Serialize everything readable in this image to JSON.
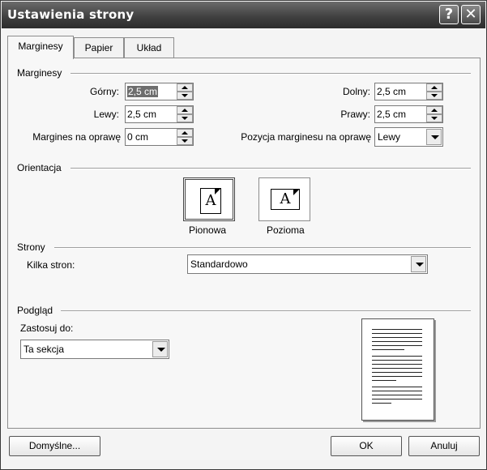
{
  "window": {
    "title": "Ustawienia strony",
    "help_glyph": "?",
    "close_glyph": "✕"
  },
  "tabs": [
    {
      "label": "Marginesy",
      "active": true
    },
    {
      "label": "Papier",
      "active": false
    },
    {
      "label": "Układ",
      "active": false
    }
  ],
  "margins": {
    "section": "Marginesy",
    "top_label": "Górny:",
    "top_value": "2,5 cm",
    "bottom_label": "Dolny:",
    "bottom_value": "2,5 cm",
    "left_label": "Lewy:",
    "left_value": "2,5 cm",
    "right_label": "Prawy:",
    "right_value": "2,5 cm",
    "gutter_label": "Margines na oprawę",
    "gutter_value": "0 cm",
    "gutter_pos_label": "Pozycja marginesu na oprawę",
    "gutter_pos_value": "Lewy"
  },
  "orientation": {
    "section": "Orientacja",
    "portrait_label": "Pionowa",
    "landscape_label": "Pozioma",
    "glyph": "A",
    "selected": "portrait"
  },
  "pages": {
    "section": "Strony",
    "multiple_label": "Kilka stron:",
    "multiple_value": "Standardowo"
  },
  "preview": {
    "section": "Podgląd",
    "apply_label": "Zastosuj do:",
    "apply_value": "Ta sekcja"
  },
  "buttons": {
    "default": "Domyślne...",
    "ok": "OK",
    "cancel": "Anuluj"
  },
  "colors": {
    "titlebar": "#3e3e3e",
    "selection": "#6e6e6e"
  }
}
